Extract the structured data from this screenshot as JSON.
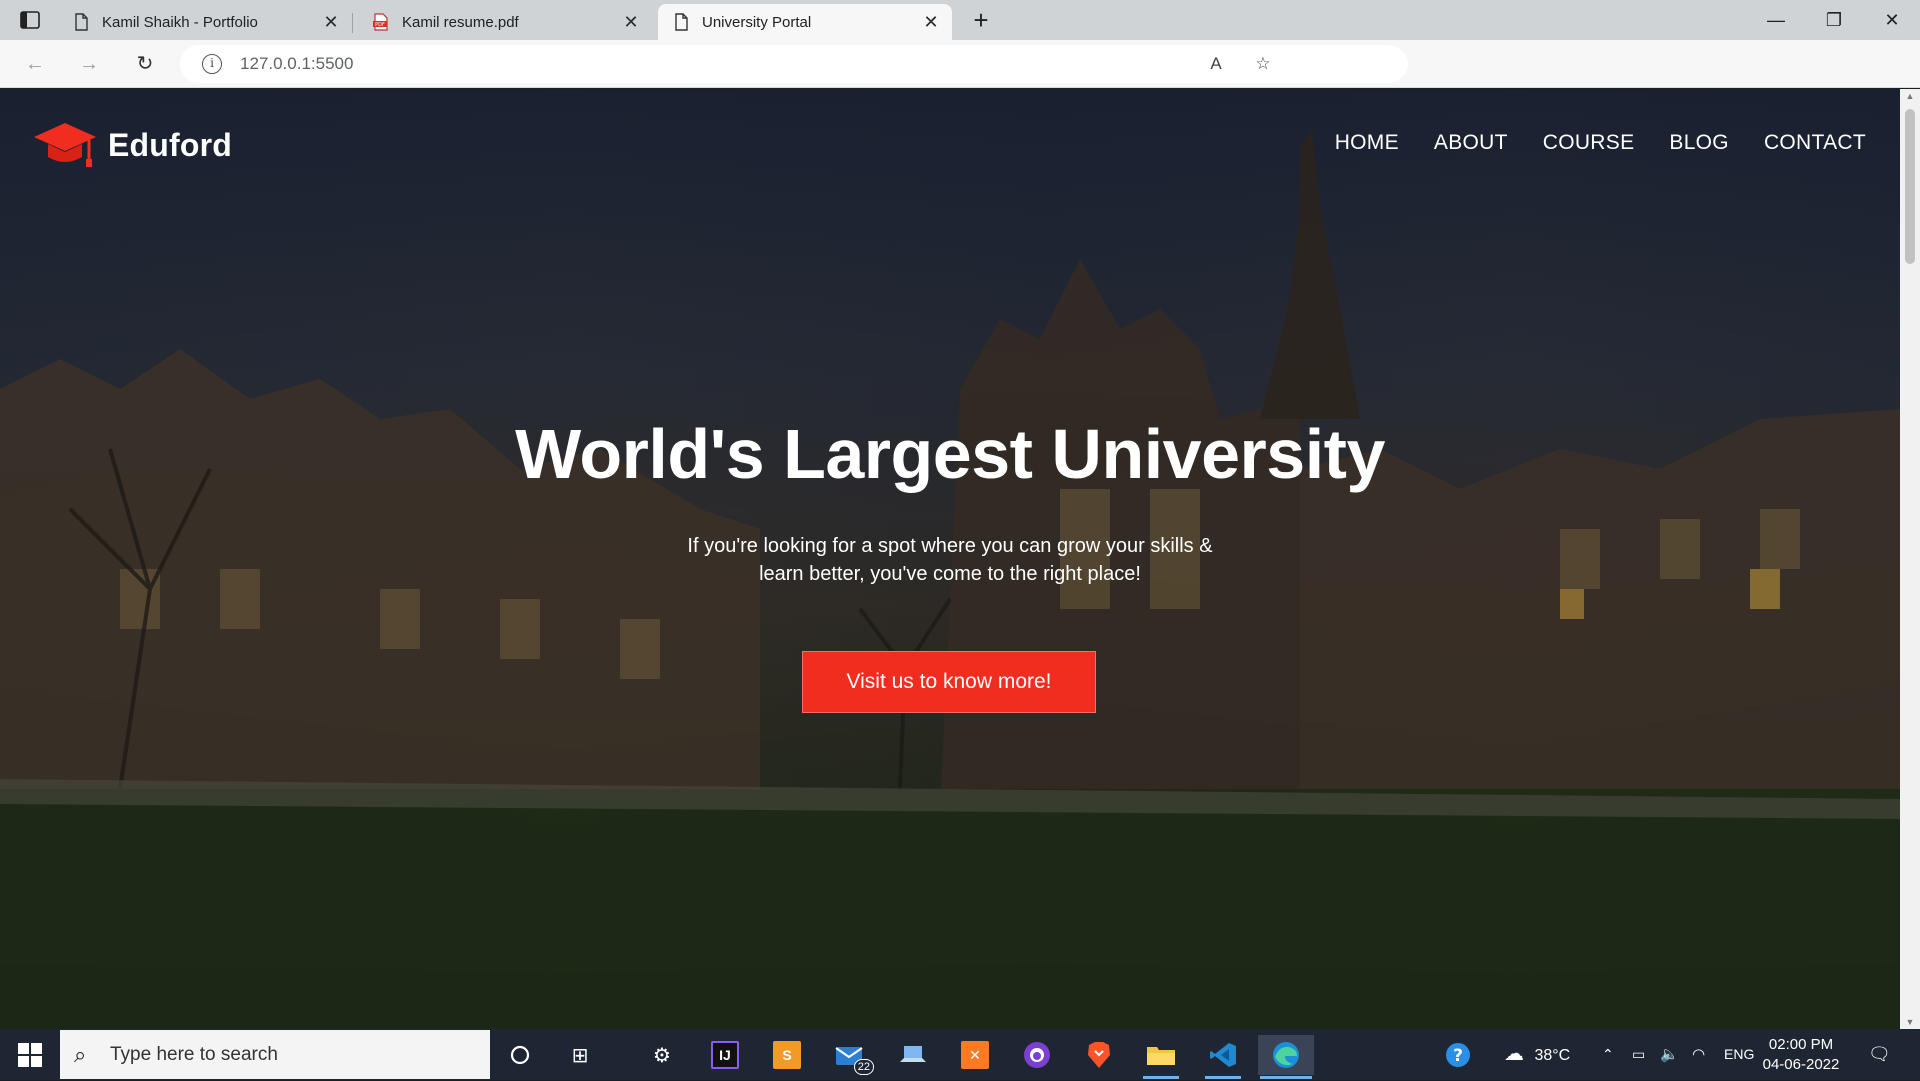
{
  "browser": {
    "tabs": [
      {
        "title": "Kamil Shaikh - Portfolio",
        "icon": "page-icon",
        "active": false
      },
      {
        "title": "Kamil resume.pdf",
        "icon": "pdf-icon",
        "active": false
      },
      {
        "title": "University Portal",
        "icon": "page-icon",
        "active": true
      }
    ],
    "close_glyph": "✕",
    "new_tab_glyph": "+",
    "url": "127.0.0.1:5500",
    "window_controls": {
      "minimize": "—",
      "restore": "❐",
      "close": "✕"
    }
  },
  "site": {
    "brand": "Eduford",
    "nav": [
      "HOME",
      "ABOUT",
      "COURSE",
      "BLOG",
      "CONTACT"
    ],
    "hero": {
      "title": "World's Largest University",
      "subtitle_line1": "If you're looking for a spot where you can grow your skills &",
      "subtitle_line2": "learn better, you've come to the right place!",
      "cta": "Visit us to know more!"
    },
    "accent_color": "#f12d20"
  },
  "taskbar": {
    "search_placeholder": "Type here to search",
    "mail_badge": "22",
    "weather": "38°C",
    "language": "ENG",
    "time": "02:00 PM",
    "date": "04-06-2022"
  }
}
